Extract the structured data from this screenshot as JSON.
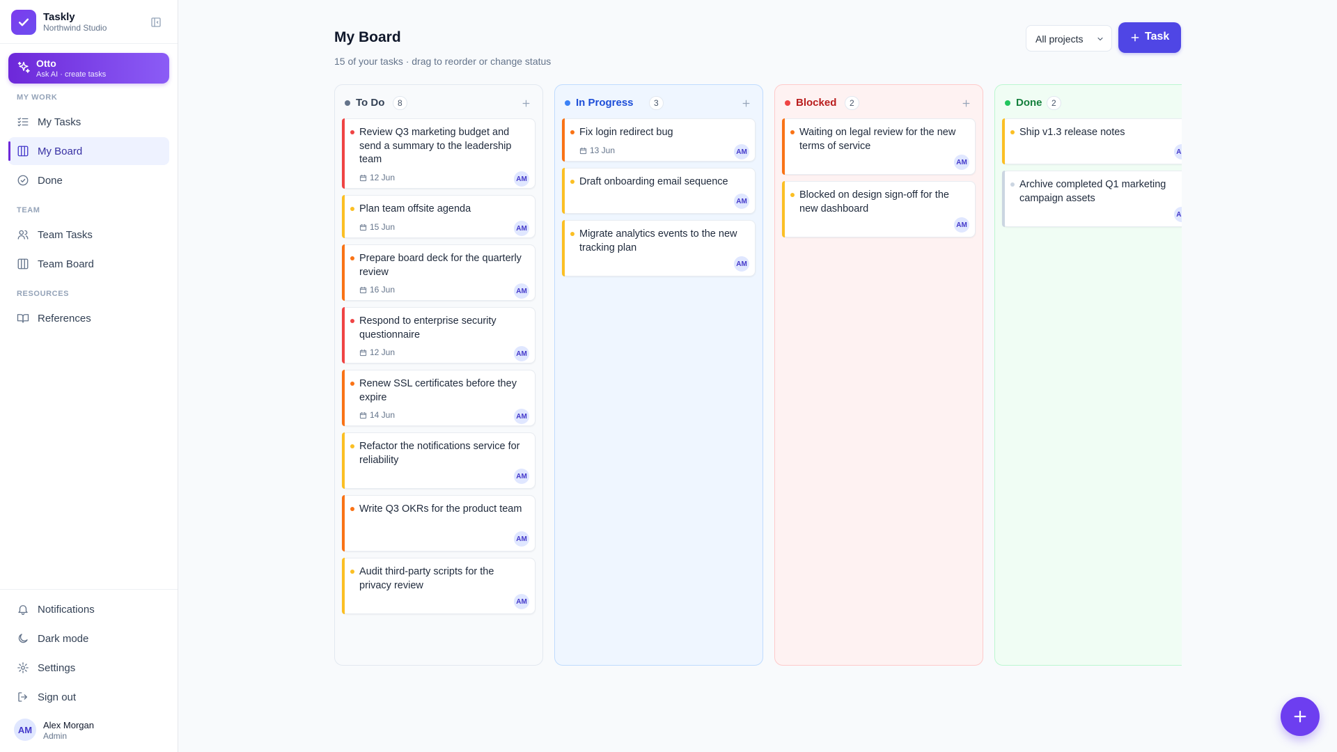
{
  "brand": {
    "name": "Taskly",
    "workspace": "Northwind Studio"
  },
  "otto": {
    "title": "Otto",
    "subtitle": "Ask AI · create tasks"
  },
  "sidebar": {
    "sections": {
      "my_work": "MY WORK",
      "team": "TEAM",
      "resources": "RESOURCES"
    },
    "items": {
      "my_tasks": "My Tasks",
      "my_board": "My Board",
      "done": "Done",
      "team_tasks": "Team Tasks",
      "team_board": "Team Board",
      "references": "References"
    },
    "bottom": {
      "notifications": "Notifications",
      "dark_mode": "Dark mode",
      "settings": "Settings",
      "sign_out": "Sign out"
    },
    "user": {
      "initials": "AM",
      "name": "Alex Morgan",
      "role": "Admin"
    }
  },
  "header": {
    "title": "My Board",
    "subtitle": "15 of your tasks · drag to reorder or change status",
    "project_filter": "All projects",
    "new_task_label": "Task"
  },
  "colors": {
    "urgent": "#ef4444",
    "high": "#f97316",
    "medium": "#fbbf24",
    "low": "#cbd5e1",
    "accent": "#4f46e5"
  },
  "columns": [
    {
      "title": "To Do",
      "count": "8",
      "dot": "#64748b",
      "title_color": "#334155",
      "bg": "#f8fafc",
      "border": "#e2e8f0",
      "cards": [
        {
          "title": "Review Q3 marketing budget and send a summary to the leadership team",
          "date": "12 Jun",
          "priority": "urgent",
          "assignee": "AM"
        },
        {
          "title": "Plan team offsite agenda",
          "date": "15 Jun",
          "priority": "medium",
          "assignee": "AM"
        },
        {
          "title": "Prepare board deck for the quarterly review",
          "date": "16 Jun",
          "priority": "high",
          "assignee": "AM"
        },
        {
          "title": "Respond to enterprise security questionnaire",
          "date": "12 Jun",
          "priority": "urgent",
          "assignee": "AM"
        },
        {
          "title": "Renew SSL certificates before they expire",
          "date": "14 Jun",
          "priority": "high",
          "assignee": "AM"
        },
        {
          "title": "Refactor the notifications service for reliability",
          "date": "",
          "priority": "medium",
          "assignee": "AM"
        },
        {
          "title": "Write Q3 OKRs for the product team",
          "date": "",
          "priority": "high",
          "assignee": "AM"
        },
        {
          "title": "Audit third-party scripts for the privacy review",
          "date": "",
          "priority": "medium",
          "assignee": "AM"
        }
      ]
    },
    {
      "title": "In Progress",
      "count": "3",
      "dot": "#3b82f6",
      "title_color": "#1d4ed8",
      "bg": "#eff6ff",
      "border": "#bfdbfe",
      "cards": [
        {
          "title": "Fix login redirect bug",
          "date": "13 Jun",
          "priority": "high",
          "assignee": "AM"
        },
        {
          "title": "Draft onboarding email sequence",
          "date": "",
          "priority": "medium",
          "assignee": "AM"
        },
        {
          "title": "Migrate analytics events to the new tracking plan",
          "date": "",
          "priority": "medium",
          "assignee": "AM"
        }
      ]
    },
    {
      "title": "Blocked",
      "count": "2",
      "dot": "#ef4444",
      "title_color": "#b91c1c",
      "bg": "#fef2f2",
      "border": "#fecaca",
      "cards": [
        {
          "title": "Waiting on legal review for the new terms of service",
          "date": "",
          "priority": "high",
          "assignee": "AM"
        },
        {
          "title": "Blocked on design sign-off for the new dashboard",
          "date": "",
          "priority": "medium",
          "assignee": "AM"
        }
      ]
    },
    {
      "title": "Done",
      "count": "2",
      "dot": "#22c55e",
      "title_color": "#15803d",
      "bg": "#f0fdf4",
      "border": "#bbf7d0",
      "cards": [
        {
          "title": "Ship v1.3 release notes",
          "date": "",
          "priority": "medium",
          "assignee": "AM"
        },
        {
          "title": "Archive completed Q1 marketing campaign assets",
          "date": "",
          "priority": "low",
          "assignee": "AM"
        }
      ]
    }
  ]
}
